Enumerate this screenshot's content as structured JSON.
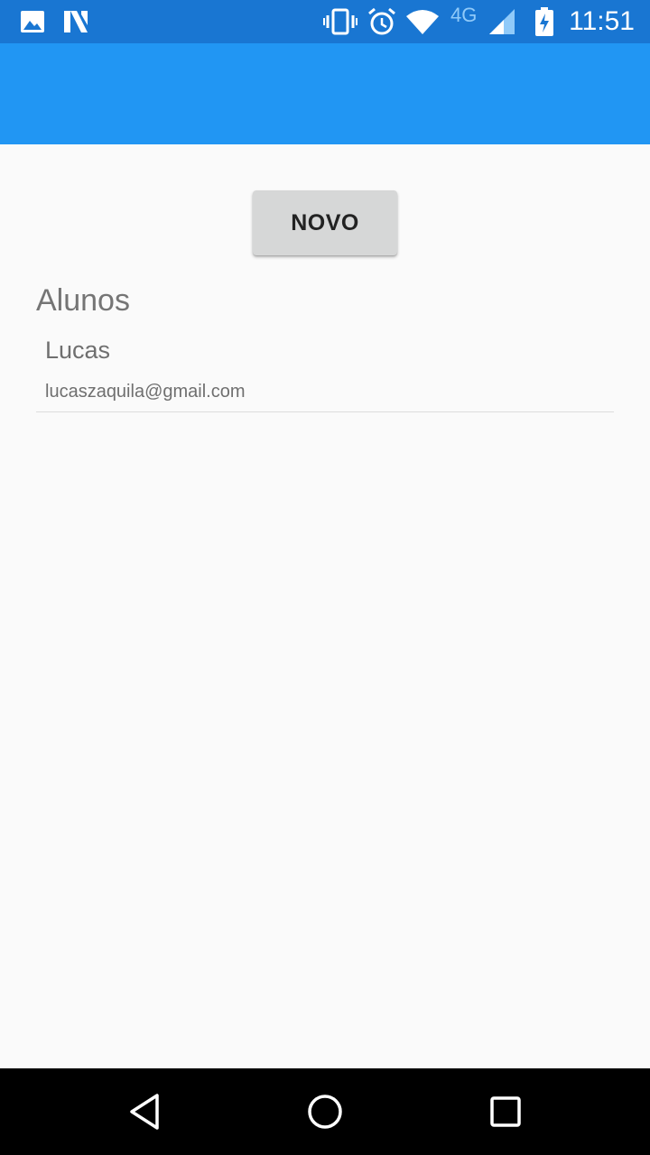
{
  "status_bar": {
    "time": "11:51",
    "network": "4G",
    "icons": [
      "image-icon",
      "n-notification-icon",
      "vibrate-icon",
      "alarm-icon",
      "wifi-icon",
      "cellular-signal-icon",
      "battery-charging-icon"
    ],
    "background": "#1976d2"
  },
  "app_bar": {
    "background": "#2196f3"
  },
  "main": {
    "new_button_label": "NOVO",
    "section_title": "Alunos",
    "students": [
      {
        "name": "Lucas",
        "email": "lucaszaquila@gmail.com"
      }
    ]
  },
  "nav_bar": {
    "icons": [
      "back-icon",
      "home-icon",
      "recents-icon"
    ]
  }
}
